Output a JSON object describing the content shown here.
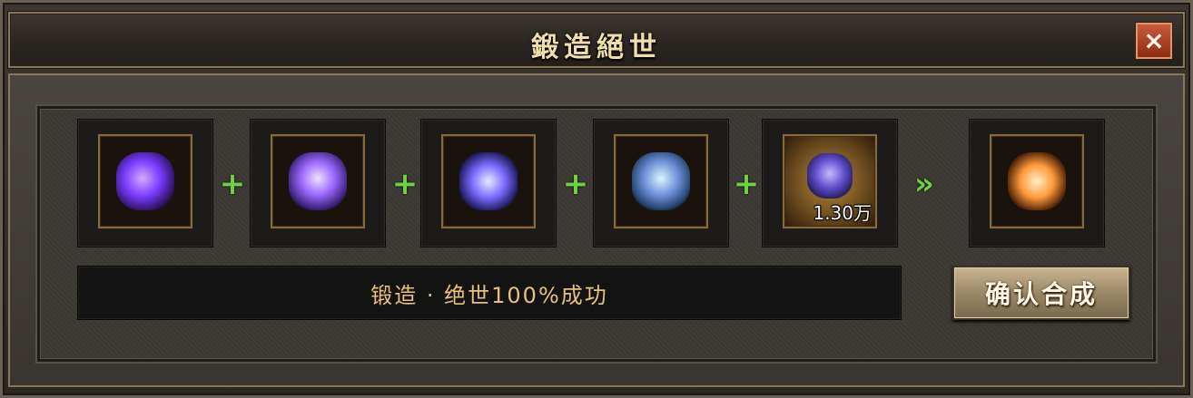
{
  "window": {
    "title": "鍛造絕世",
    "close_label": "×"
  },
  "materials": [
    {
      "name": "purple-material-icon",
      "color": "#8a4cff",
      "count": ""
    },
    {
      "name": "violet-material-icon",
      "color": "#9c6bff",
      "count": ""
    },
    {
      "name": "blue-violet-material-icon",
      "color": "#7d6bff",
      "count": ""
    },
    {
      "name": "teal-crystal-material-icon",
      "color": "#6f8fd9",
      "count": ""
    },
    {
      "name": "ore-material-icon",
      "color": "#b98a3c",
      "count": "1.30万"
    }
  ],
  "result_item": {
    "name": "golden-equipment-icon",
    "color": "#ff9a3c"
  },
  "operators": {
    "plus": "+",
    "arrow": "»"
  },
  "status": {
    "text": "锻造 · 绝世100%成功"
  },
  "actions": {
    "confirm_label": "确认合成"
  }
}
